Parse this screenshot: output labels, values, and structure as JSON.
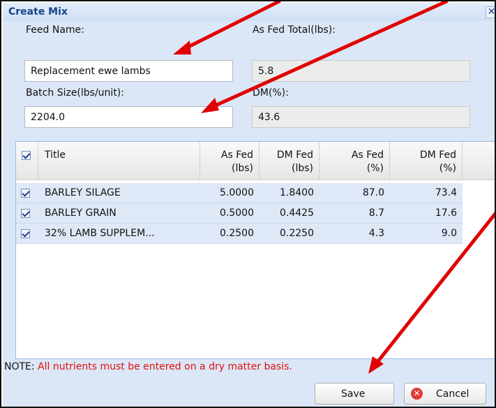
{
  "dialog": {
    "title": "Create Mix",
    "close_glyph": "✕"
  },
  "form": {
    "feed_name_label": "Feed Name:",
    "feed_name_value": "Replacement ewe lambs",
    "as_fed_total_label": "As Fed Total(lbs):",
    "as_fed_total_value": "5.8",
    "batch_size_label": "Batch Size(lbs/unit):",
    "batch_size_value": "2204.0",
    "dm_label": "DM(%):",
    "dm_value": "43.6"
  },
  "grid": {
    "columns": [
      {
        "line1": "Title",
        "line2": ""
      },
      {
        "line1": "As Fed",
        "line2": "(lbs)"
      },
      {
        "line1": "DM Fed",
        "line2": "(lbs)"
      },
      {
        "line1": "As Fed",
        "line2": "(%)"
      },
      {
        "line1": "DM Fed",
        "line2": "(%)"
      }
    ],
    "rows": [
      {
        "title": "BARLEY SILAGE",
        "as_fed_lbs": "5.0000",
        "dm_fed_lbs": "1.8400",
        "as_fed_pct": "87.0",
        "dm_fed_pct": "73.4",
        "checked": true
      },
      {
        "title": "BARLEY GRAIN",
        "as_fed_lbs": "0.5000",
        "dm_fed_lbs": "0.4425",
        "as_fed_pct": "8.7",
        "dm_fed_pct": "17.6",
        "checked": true
      },
      {
        "title": "32% LAMB SUPPLEM...",
        "as_fed_lbs": "0.2500",
        "dm_fed_lbs": "0.2250",
        "as_fed_pct": "4.3",
        "dm_fed_pct": "9.0",
        "checked": true
      }
    ]
  },
  "note": {
    "label": "NOTE:",
    "text": " All nutrients must be entered on a dry matter basis."
  },
  "buttons": {
    "save_label": "Save",
    "cancel_label": "Cancel",
    "cancel_icon": "close-circle-icon"
  },
  "colors": {
    "title": "#15428b",
    "note_text": "#e01010",
    "row_bg": "#dfe8f6",
    "arrow": "#e00000"
  }
}
